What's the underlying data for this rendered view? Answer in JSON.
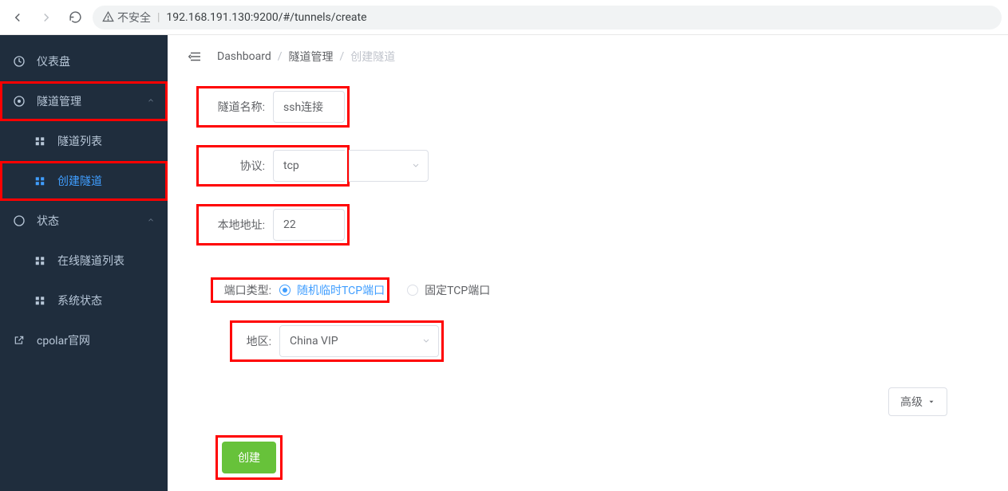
{
  "browser": {
    "insecure_label": "不安全",
    "url": "192.168.191.130:9200/#/tunnels/create"
  },
  "sidebar": {
    "items": [
      {
        "label": "仪表盘"
      },
      {
        "label": "隧道管理"
      },
      {
        "label": "隧道列表"
      },
      {
        "label": "创建隧道"
      },
      {
        "label": "状态"
      },
      {
        "label": "在线隧道列表"
      },
      {
        "label": "系统状态"
      },
      {
        "label": "cpolar官网"
      }
    ]
  },
  "breadcrumb": {
    "root": "Dashboard",
    "parent": "隧道管理",
    "current": "创建隧道"
  },
  "form": {
    "name": {
      "label": "隧道名称:",
      "value": "ssh连接"
    },
    "protocol": {
      "label": "协议:",
      "value": "tcp"
    },
    "local_addr": {
      "label": "本地地址:",
      "value": "22"
    },
    "port_type": {
      "label": "端口类型:",
      "options": [
        {
          "label": "随机临时TCP端口",
          "checked": true
        },
        {
          "label": "固定TCP端口",
          "checked": false
        }
      ]
    },
    "region": {
      "label": "地区:",
      "value": "China VIP"
    },
    "advanced_label": "高级",
    "submit_label": "创建"
  }
}
